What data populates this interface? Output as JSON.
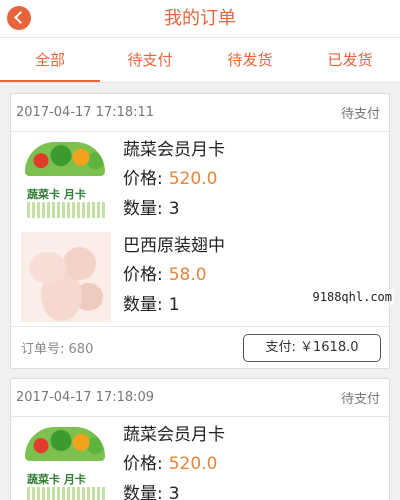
{
  "header": {
    "title": "我的订单",
    "back_icon": "chevron-left-icon"
  },
  "tabs": [
    "全部",
    "待支付",
    "待发货",
    "已发货"
  ],
  "orders": [
    {
      "time": "2017-04-17 17:18:11",
      "status": "待支付",
      "items": [
        {
          "name": "蔬菜会员月卡",
          "price_label": "价格:",
          "price": "520.0",
          "qty_label": "数量:",
          "qty": "3",
          "thumb_text": "蔬菜卡 月卡"
        },
        {
          "name": "巴西原装翅中",
          "price_label": "价格:",
          "price": "58.0",
          "qty_label": "数量:",
          "qty": "1"
        }
      ],
      "order_no_label": "订单号:",
      "order_no": "680",
      "pay_label": "支付: ￥1618.0"
    },
    {
      "time": "2017-04-17 17:18:09",
      "status": "待支付",
      "items": [
        {
          "name": "蔬菜会员月卡",
          "price_label": "价格:",
          "price": "520.0",
          "qty_label": "数量:",
          "qty": "3",
          "thumb_text": "蔬菜卡 月卡"
        }
      ]
    }
  ],
  "watermark": "9188qhl.com",
  "colors": {
    "accent": "#e8643a",
    "price": "#e8843a"
  }
}
